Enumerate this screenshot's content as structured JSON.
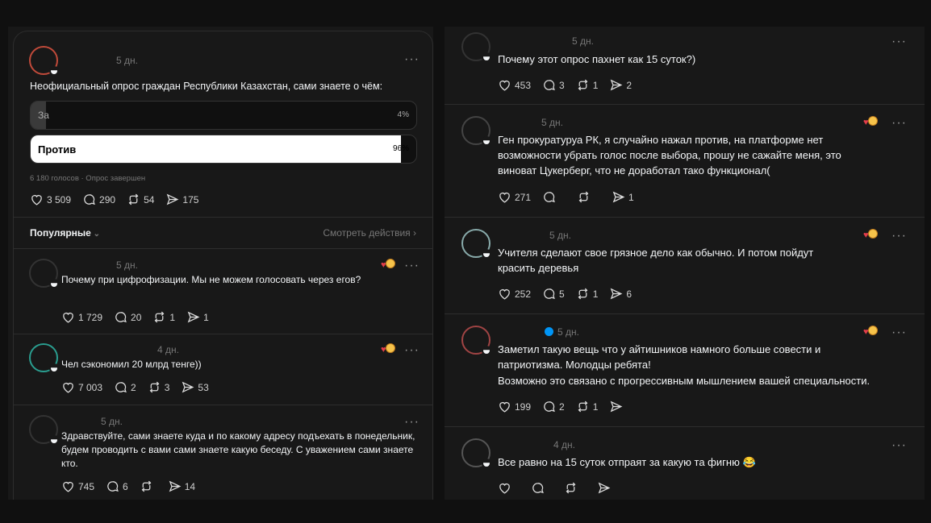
{
  "main_post": {
    "time": "5 дн.",
    "text": "Неофициальный опрос граждан Республики Казахстан, сами знаете о чём:",
    "poll": {
      "options": [
        {
          "label": "За",
          "percent_text": "4%",
          "share": 0.04
        },
        {
          "label": "Против",
          "percent_text": "96%",
          "share": 0.96
        }
      ],
      "meta": "6 180 голосов · Опрос завершен"
    },
    "likes": "3 509",
    "replies": "290",
    "reposts": "54",
    "shares": "175"
  },
  "filter": {
    "sort_label": "Популярные",
    "activity_link": "Смотреть действия"
  },
  "left_replies": [
    {
      "time": "5 дн.",
      "text": "Почему при цифрофизации. Мы не можем голосовать через егов?",
      "likes": "1 729",
      "replies": "20",
      "reposts": "1",
      "shares": "1"
    },
    {
      "time": "4 дн.",
      "text": "Чел сэкономил 20 млрд тенге))",
      "likes": "7 003",
      "replies": "2",
      "reposts": "3",
      "shares": "53"
    },
    {
      "time": "5 дн.",
      "text": "Здравствуйте, сами знаете куда и по какому адресу подъехать в понедельник, будем проводить с вами сами знаете какую беседу. С уважением сами знаете кто.",
      "likes": "745",
      "replies": "6",
      "reposts": "",
      "shares": "14"
    }
  ],
  "right_replies": [
    {
      "time": "5 дн.",
      "text": "Почему этот опрос пахнет как 15 суток?)",
      "likes": "453",
      "replies": "3",
      "reposts": "1",
      "shares": "2"
    },
    {
      "time": "5 дн.",
      "text": "Ген прокуратуруа РК, я случайно нажал против, на платформе нет возможности убрать голос после выбора, прошу не сажайте меня, это виноват Цукерберг, что не доработал тако функционал(",
      "likes": "271",
      "replies": "",
      "reposts": "",
      "shares": "1"
    },
    {
      "time": "5 дн.",
      "text": "Учителя сделают свое грязное дело как обычно. И потом пойдут красить деревья",
      "likes": "252",
      "replies": "5",
      "reposts": "1",
      "shares": "6"
    },
    {
      "time": "5 дн.",
      "text_lines": [
        "Заметил такую вещь что у айтишников намного больше совести и патриотизма. Молодцы ребята!",
        "Возможно это связано с прогрессивным мышлением вашей специальности."
      ],
      "likes": "199",
      "replies": "2",
      "reposts": "1",
      "shares": ""
    },
    {
      "time": "4 дн.",
      "text": "Все равно на 15 суток отпраят за какую та фигню",
      "emoji": "😂",
      "likes": "",
      "replies": "",
      "reposts": "",
      "shares": ""
    }
  ],
  "more_glyph": "···",
  "colors": {
    "background": "#181818",
    "frame": "#101010",
    "text": "#f3f5f7",
    "muted": "#777777",
    "divider": "#2d2d2d",
    "verified": "#0095f6",
    "react_heart": "#e23d4a"
  }
}
